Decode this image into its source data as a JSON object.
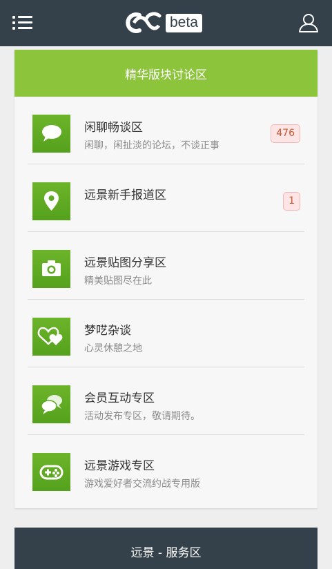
{
  "header": {
    "logo_badge": "beta",
    "menu_icon": "menu-icon",
    "user_icon": "user-icon"
  },
  "section": {
    "title": "精华版块讨论区",
    "forums": [
      {
        "title": "闲聊畅谈区",
        "desc": "闲聊，闲扯淡的论坛，不谈正事",
        "badge": "476",
        "icon": "chat-bubble-icon"
      },
      {
        "title": "远景新手报道区",
        "desc": "",
        "badge": "1",
        "icon": "map-pin-icon"
      },
      {
        "title": "远景贴图分享区",
        "desc": "精美贴图尽在此",
        "badge": "",
        "icon": "camera-icon"
      },
      {
        "title": "梦呓杂谈",
        "desc": "心灵休憩之地",
        "badge": "",
        "icon": "hearts-icon"
      },
      {
        "title": "会员互动专区",
        "desc": "活动发布专区，敬请期待。",
        "badge": "",
        "icon": "chat-bubbles-icon"
      },
      {
        "title": "远景游戏专区",
        "desc": "游戏爱好者交流约战专用版",
        "badge": "",
        "icon": "gamepad-icon"
      }
    ]
  },
  "footer_section": {
    "title": "远景 - 服务区"
  },
  "colors": {
    "topbar": "#34404a",
    "accent": "#8cc53c",
    "icon_bg": "#5dab23",
    "badge_text": "#c9552f"
  }
}
